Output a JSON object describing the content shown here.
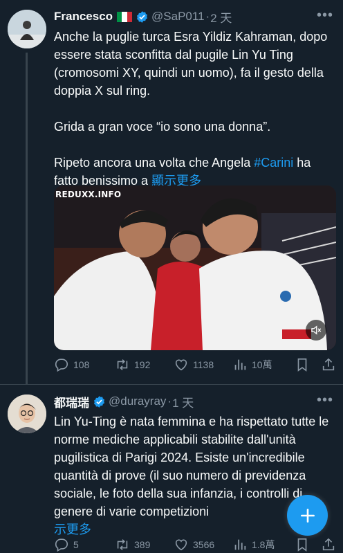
{
  "tweet1": {
    "name": "Francesco",
    "handle": "@SaP011",
    "sep": "·",
    "time": "2 天",
    "text_main": "Anche la puglie turca Esra Yildiz Kahraman, dopo essere stata sconfitta dal pugile Lin Yu Ting (cromosomi XY, quindi un uomo), fa il gesto della doppia X sul ring.\n\nGrida a gran voce “io sono una donna”.\n\nRipeto ancora una volta che Angela ",
    "hashtag": "#Carini",
    "text_tail": " ha fatto benissimo a ",
    "show_more": "顯示更多",
    "media_watermark": "REDUXX.INFO",
    "replies": "108",
    "retweets": "192",
    "likes": "1138",
    "views": "10萬",
    "flag_colors": [
      "#009246",
      "#ffffff",
      "#ce2b37"
    ]
  },
  "tweet2": {
    "name": "都瑞瑞",
    "handle": "@durayray",
    "sep": "·",
    "time": "1 天",
    "text": "Lin Yu-Ting è nata femmina e ha rispettato tutte le norme mediche applicabili stabilite dall'unità pugilistica di Parigi 2024. Esiste un'incredibile quantità di prove (il suo numero di previdenza sociale, le foto della sua infanzia, i controlli di genere di varie competizioni",
    "show_more": "示更多",
    "replies": "5",
    "retweets": "389",
    "likes": "3566",
    "views": "1.8萬"
  },
  "icons": {
    "more": "more-horizontal-icon",
    "verified": "verified-badge-icon",
    "reply": "reply-icon",
    "retweet": "retweet-icon",
    "like": "heart-icon",
    "views": "views-chart-icon",
    "bookmark": "bookmark-icon",
    "share": "share-icon",
    "mute": "muted-speaker-icon",
    "compose": "plus-icon"
  },
  "colors": {
    "background": "#15202b",
    "text": "#f7f9f9",
    "secondary": "#8b98a5",
    "accent": "#1d9bf0",
    "divider": "#38444d"
  }
}
